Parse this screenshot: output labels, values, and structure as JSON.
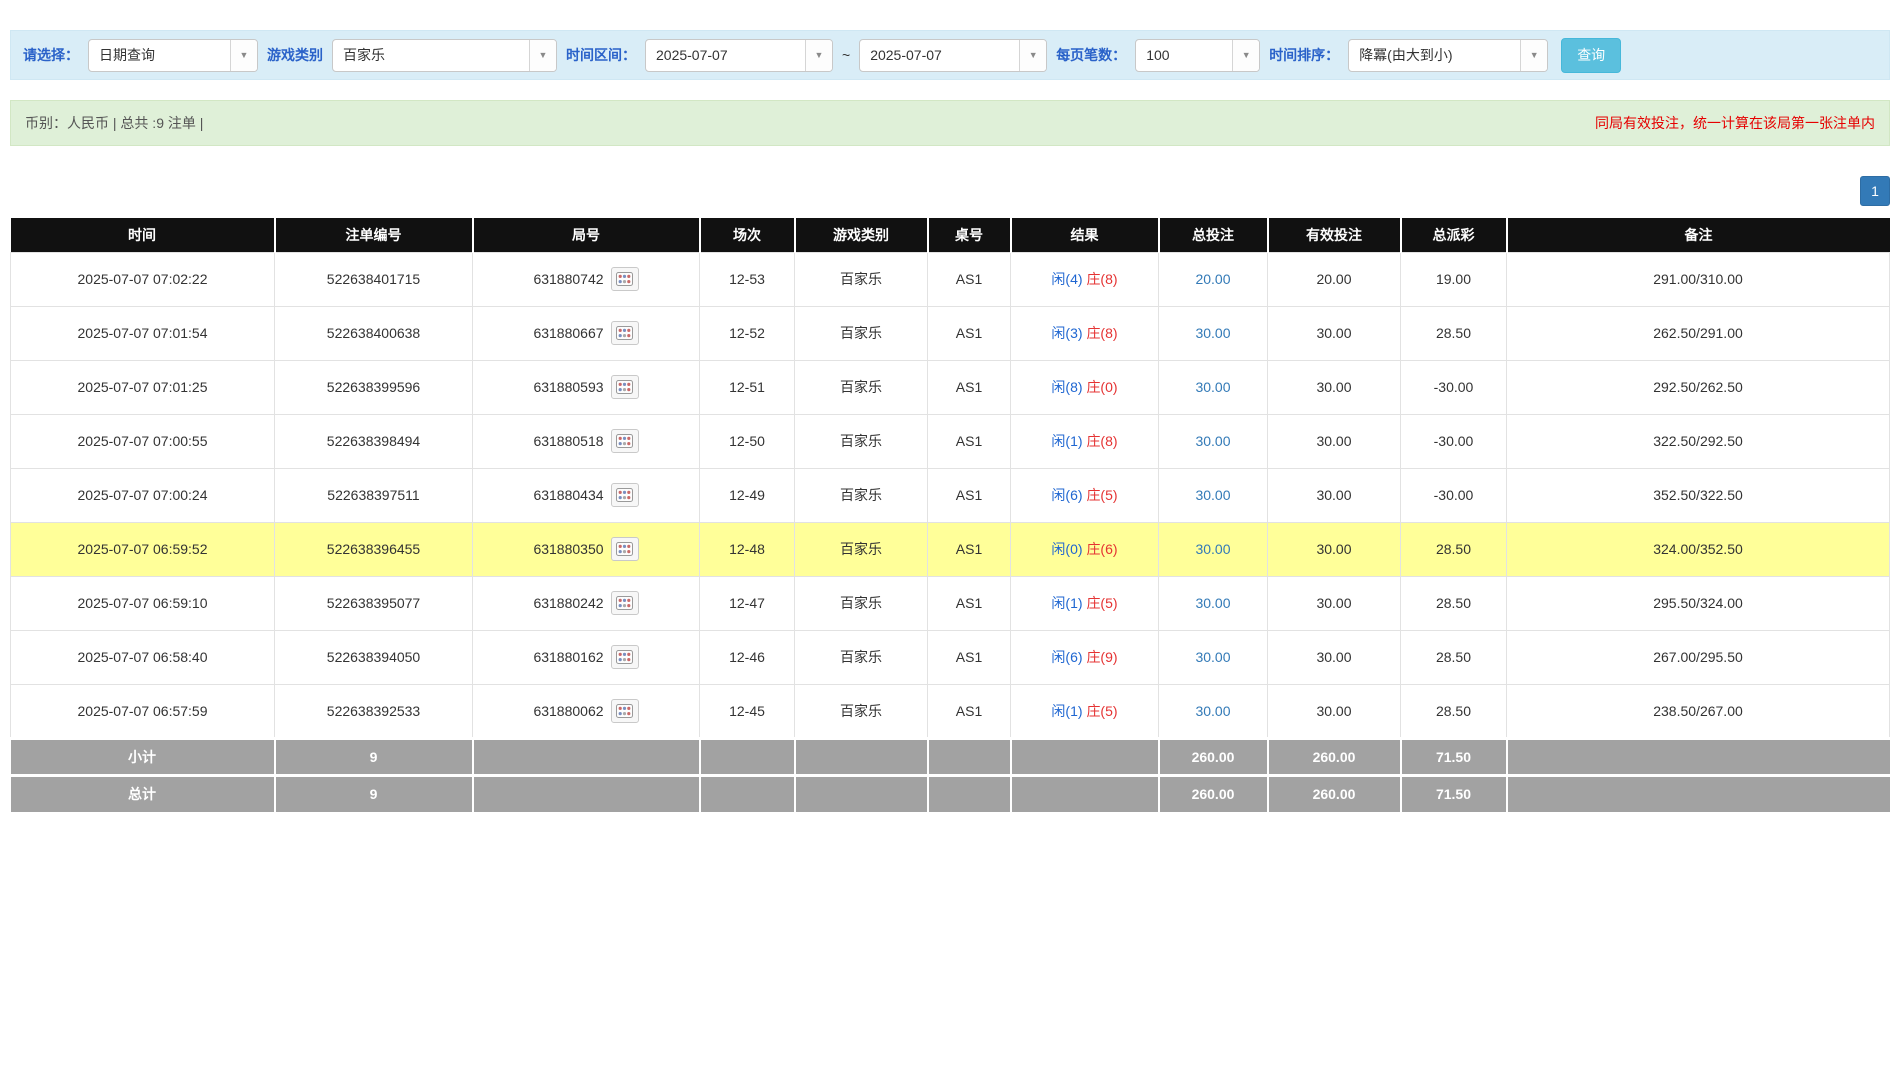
{
  "filters": {
    "labels": {
      "select": "请选择：",
      "game": "游戏类别",
      "range": "时间区间：",
      "page_size": "每页笔数：",
      "sort": "时间排序："
    },
    "query_type": "日期查询",
    "game_type": "百家乐",
    "date_from": "2025-07-07",
    "range_separator": "~",
    "date_to": "2025-07-07",
    "page_size": "100",
    "sort_order": "降冪(由大到小)",
    "search_button": "查询"
  },
  "summary": {
    "left": "币别：人民币 | 总共 :9 注单 |",
    "right": "同局有效投注，统一计算在该局第一张注单内"
  },
  "pagination": {
    "current": "1"
  },
  "table": {
    "headers": [
      "时间",
      "注单编号",
      "局号",
      "场次",
      "游戏类别",
      "桌号",
      "结果",
      "总投注",
      "有效投注",
      "总派彩",
      "备注"
    ],
    "rows": [
      {
        "time": "2025-07-07 07:02:22",
        "bet_id": "522638401715",
        "round_id": "631880742",
        "session": "12-53",
        "game": "百家乐",
        "table_no": "AS1",
        "result_player": "闲(4)",
        "result_banker": "庄(8)",
        "total_bet": "20.00",
        "valid_bet": "20.00",
        "payout": "19.00",
        "note": "291.00/310.00",
        "highlight": false
      },
      {
        "time": "2025-07-07 07:01:54",
        "bet_id": "522638400638",
        "round_id": "631880667",
        "session": "12-52",
        "game": "百家乐",
        "table_no": "AS1",
        "result_player": "闲(3)",
        "result_banker": "庄(8)",
        "total_bet": "30.00",
        "valid_bet": "30.00",
        "payout": "28.50",
        "note": "262.50/291.00",
        "highlight": false
      },
      {
        "time": "2025-07-07 07:01:25",
        "bet_id": "522638399596",
        "round_id": "631880593",
        "session": "12-51",
        "game": "百家乐",
        "table_no": "AS1",
        "result_player": "闲(8)",
        "result_banker": "庄(0)",
        "total_bet": "30.00",
        "valid_bet": "30.00",
        "payout": "-30.00",
        "note": "292.50/262.50",
        "highlight": false
      },
      {
        "time": "2025-07-07 07:00:55",
        "bet_id": "522638398494",
        "round_id": "631880518",
        "session": "12-50",
        "game": "百家乐",
        "table_no": "AS1",
        "result_player": "闲(1)",
        "result_banker": "庄(8)",
        "total_bet": "30.00",
        "valid_bet": "30.00",
        "payout": "-30.00",
        "note": "322.50/292.50",
        "highlight": false
      },
      {
        "time": "2025-07-07 07:00:24",
        "bet_id": "522638397511",
        "round_id": "631880434",
        "session": "12-49",
        "game": "百家乐",
        "table_no": "AS1",
        "result_player": "闲(6)",
        "result_banker": "庄(5)",
        "total_bet": "30.00",
        "valid_bet": "30.00",
        "payout": "-30.00",
        "note": "352.50/322.50",
        "highlight": false
      },
      {
        "time": "2025-07-07 06:59:52",
        "bet_id": "522638396455",
        "round_id": "631880350",
        "session": "12-48",
        "game": "百家乐",
        "table_no": "AS1",
        "result_player": "闲(0)",
        "result_banker": "庄(6)",
        "total_bet": "30.00",
        "valid_bet": "30.00",
        "payout": "28.50",
        "note": "324.00/352.50",
        "highlight": true
      },
      {
        "time": "2025-07-07 06:59:10",
        "bet_id": "522638395077",
        "round_id": "631880242",
        "session": "12-47",
        "game": "百家乐",
        "table_no": "AS1",
        "result_player": "闲(1)",
        "result_banker": "庄(5)",
        "total_bet": "30.00",
        "valid_bet": "30.00",
        "payout": "28.50",
        "note": "295.50/324.00",
        "highlight": false
      },
      {
        "time": "2025-07-07 06:58:40",
        "bet_id": "522638394050",
        "round_id": "631880162",
        "session": "12-46",
        "game": "百家乐",
        "table_no": "AS1",
        "result_player": "闲(6)",
        "result_banker": "庄(9)",
        "total_bet": "30.00",
        "valid_bet": "30.00",
        "payout": "28.50",
        "note": "267.00/295.50",
        "highlight": false
      },
      {
        "time": "2025-07-07 06:57:59",
        "bet_id": "522638392533",
        "round_id": "631880062",
        "session": "12-45",
        "game": "百家乐",
        "table_no": "AS1",
        "result_player": "闲(1)",
        "result_banker": "庄(5)",
        "total_bet": "30.00",
        "valid_bet": "30.00",
        "payout": "28.50",
        "note": "238.50/267.00",
        "highlight": false
      }
    ],
    "subtotal": {
      "label": "小计",
      "count": "9",
      "total_bet": "260.00",
      "valid_bet": "260.00",
      "payout": "71.50"
    },
    "grand_total": {
      "label": "总计",
      "count": "9",
      "total_bet": "260.00",
      "valid_bet": "260.00",
      "payout": "71.50"
    }
  },
  "colors": {
    "accent_blue": "#337ab7",
    "search_button_blue": "#5bc0de",
    "player_blue": "#1f66d1",
    "banker_red": "#e53333",
    "negative_red": "#e53333",
    "highlight_yellow": "#ffff99",
    "header_black": "#111111",
    "footer_gray": "#a2a2a2",
    "filter_bar_blue": "#d9edf7",
    "summary_bar_green": "#dff0d8"
  }
}
